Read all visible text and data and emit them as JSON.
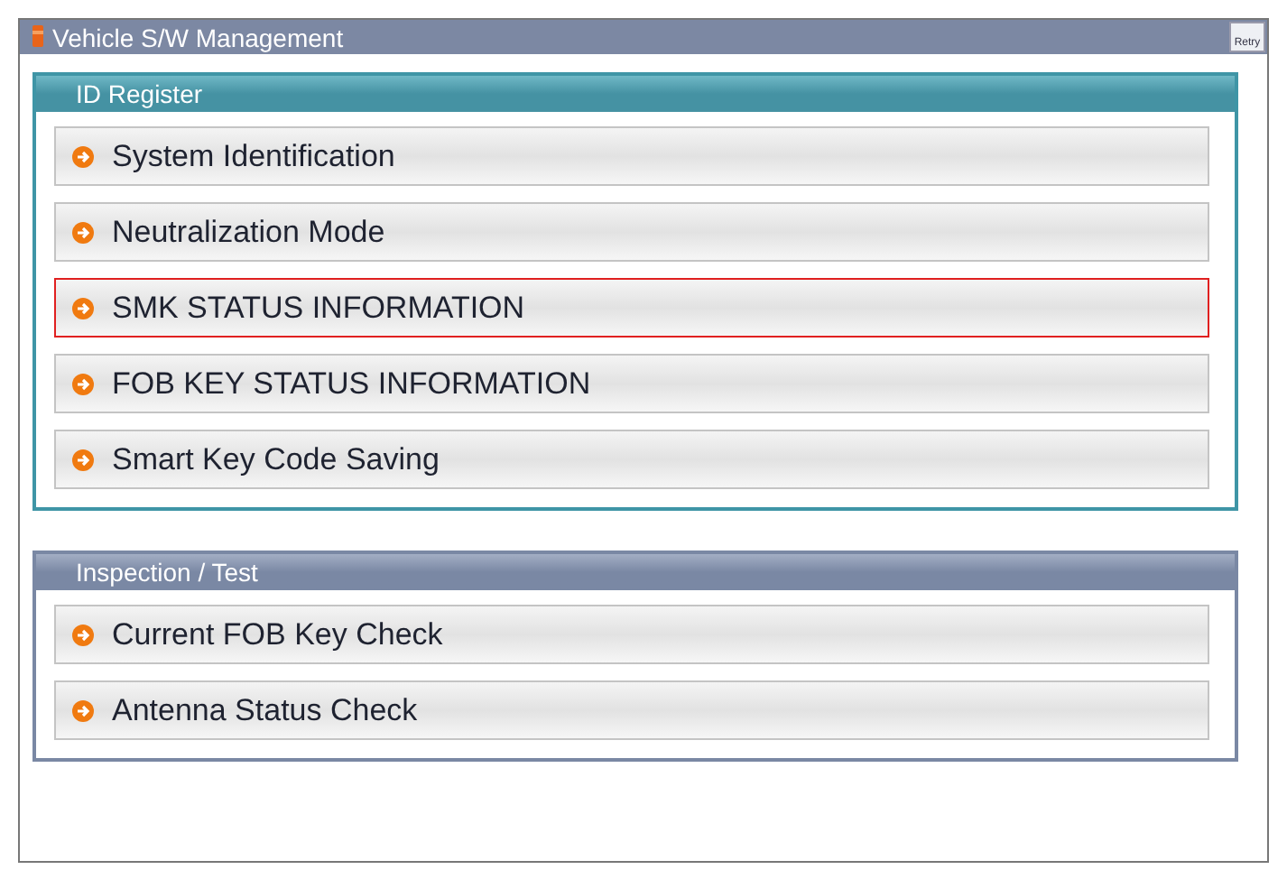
{
  "window": {
    "title": "Vehicle S/W Management",
    "retry_button": "Retry"
  },
  "sections": [
    {
      "title": "ID Register",
      "kind": "teal",
      "items": [
        {
          "label": "System Identification",
          "selected": false
        },
        {
          "label": "Neutralization Mode",
          "selected": false
        },
        {
          "label": "SMK STATUS INFORMATION",
          "selected": true
        },
        {
          "label": "FOB KEY STATUS INFORMATION",
          "selected": false
        },
        {
          "label": "Smart Key Code Saving",
          "selected": false
        }
      ]
    },
    {
      "title": "Inspection / Test",
      "kind": "slate",
      "items": [
        {
          "label": "Current FOB Key Check",
          "selected": false
        },
        {
          "label": "Antenna Status Check",
          "selected": false
        }
      ]
    }
  ]
}
